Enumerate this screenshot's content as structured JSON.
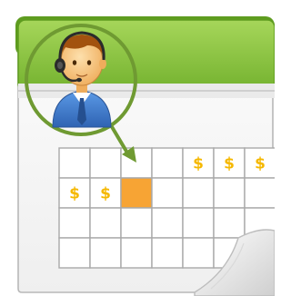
{
  "illustration": {
    "dollar_symbol": "$",
    "colors": {
      "header_green": "#8cc63f",
      "header_dark_green": "#5e9c1f",
      "page_background": "#f7f7f7",
      "grid_line": "#a9a9a9",
      "dollar_yellow": "#f5b800",
      "highlight_orange": "#f7a434",
      "circle_outline": "#6f9a32",
      "arrow_green": "#6f9a32",
      "suit_blue": "#3f7fd0",
      "skin": "#f6c57f",
      "hair": "#a2520f",
      "headset": "#2b2b2b"
    },
    "icons": [
      "calendar-icon",
      "call-center-agent-icon",
      "pointer-arrow-icon",
      "page-curl-icon"
    ],
    "grid": {
      "rows": 4,
      "columns": 7,
      "dollar_cells": [
        [
          0,
          4
        ],
        [
          0,
          5
        ],
        [
          0,
          6
        ],
        [
          1,
          0
        ],
        [
          1,
          1
        ]
      ],
      "highlighted_cell": [
        1,
        2
      ]
    }
  }
}
